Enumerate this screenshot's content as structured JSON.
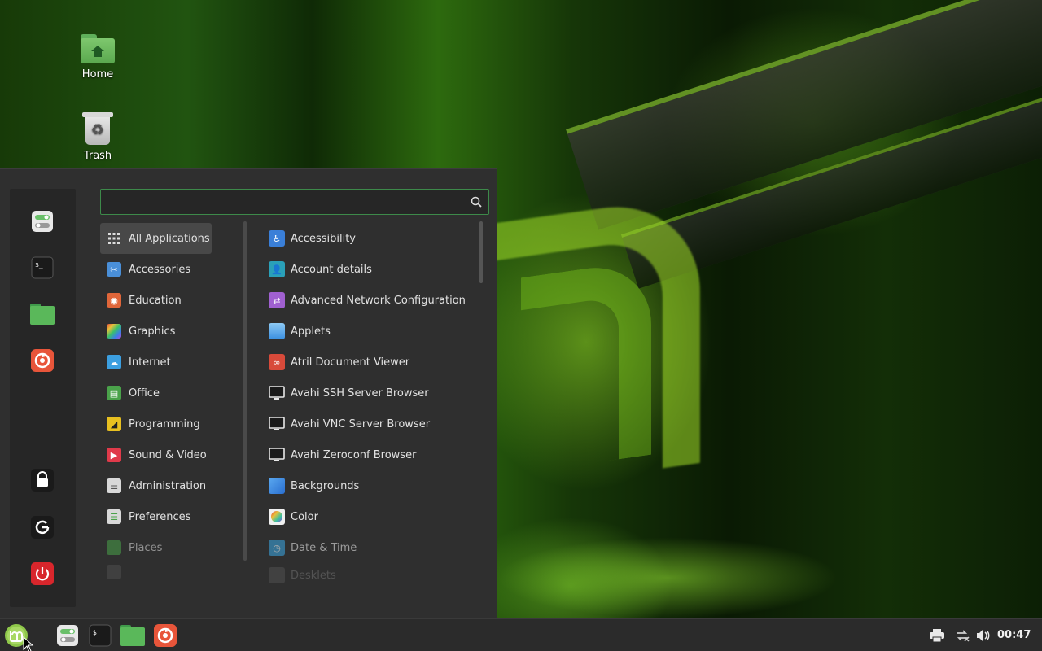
{
  "desktop": {
    "icons": [
      {
        "label": "Home",
        "icon": "home-folder-icon"
      },
      {
        "label": "Trash",
        "icon": "trash-icon"
      }
    ]
  },
  "menu": {
    "search": {
      "value": "",
      "placeholder": ""
    },
    "favorites": [
      {
        "name": "settings-toggle-icon"
      },
      {
        "name": "terminal-icon"
      },
      {
        "name": "files-folder-icon"
      },
      {
        "name": "firefox-icon"
      }
    ],
    "session": [
      {
        "name": "lock-screen-icon"
      },
      {
        "name": "logout-icon"
      },
      {
        "name": "power-icon"
      }
    ],
    "categories": [
      {
        "label": "All Applications",
        "icon": "grid-icon",
        "color": "#484848"
      },
      {
        "label": "Accessories",
        "icon": "scissors-icon",
        "color": "#4a8fd8"
      },
      {
        "label": "Education",
        "icon": "education-icon",
        "color": "#e0663a"
      },
      {
        "label": "Graphics",
        "icon": "graphics-icon",
        "color": "#b04ad8"
      },
      {
        "label": "Internet",
        "icon": "cloud-icon",
        "color": "#3c9fe0"
      },
      {
        "label": "Office",
        "icon": "office-icon",
        "color": "#4aa24a"
      },
      {
        "label": "Programming",
        "icon": "programming-icon",
        "color": "#e8c020"
      },
      {
        "label": "Sound & Video",
        "icon": "play-icon",
        "color": "#e03a4a"
      },
      {
        "label": "Administration",
        "icon": "admin-icon",
        "color": "#d8d8d8"
      },
      {
        "label": "Preferences",
        "icon": "preferences-icon",
        "color": "#d8d8d8"
      },
      {
        "label": "Places",
        "icon": "places-folder-icon",
        "color": "#4aa24a"
      }
    ],
    "apps": [
      {
        "label": "Accessibility",
        "icon": "accessibility-icon",
        "color": "#3a7fd8"
      },
      {
        "label": "Account details",
        "icon": "account-icon",
        "color": "#2aa0b8"
      },
      {
        "label": "Advanced Network Configuration",
        "icon": "network-config-icon",
        "color": "#a060d0"
      },
      {
        "label": "Applets",
        "icon": "applets-icon",
        "color": "#58a8e8"
      },
      {
        "label": "Atril Document Viewer",
        "icon": "atril-icon",
        "color": "#d84a3a"
      },
      {
        "label": "Avahi SSH Server Browser",
        "icon": "monitor-icon",
        "color": "#e8e8e8"
      },
      {
        "label": "Avahi VNC Server Browser",
        "icon": "monitor-icon",
        "color": "#e8e8e8"
      },
      {
        "label": "Avahi Zeroconf Browser",
        "icon": "monitor-icon",
        "color": "#e8e8e8"
      },
      {
        "label": "Backgrounds",
        "icon": "backgrounds-icon",
        "color": "#3a8fe0"
      },
      {
        "label": "Color",
        "icon": "color-icon",
        "color": "#f0f0f0"
      },
      {
        "label": "Date & Time",
        "icon": "clock-icon",
        "color": "#3aa0d8"
      },
      {
        "label": "Desklets",
        "icon": "desklets-icon",
        "color": "#888888"
      }
    ]
  },
  "taskbar": {
    "menu_button": "mint-logo-icon",
    "launchers": [
      {
        "name": "settings-toggle-icon"
      },
      {
        "name": "terminal-icon"
      },
      {
        "name": "files-folder-icon"
      },
      {
        "name": "firefox-icon"
      }
    ],
    "tray": [
      {
        "name": "printer-icon"
      },
      {
        "name": "network-icon"
      },
      {
        "name": "volume-icon"
      }
    ],
    "clock": "00:47"
  },
  "colors": {
    "accent": "#3d8a4a",
    "menu_bg": "#2f2f2f",
    "panel_bg": "#2b2b2b"
  }
}
